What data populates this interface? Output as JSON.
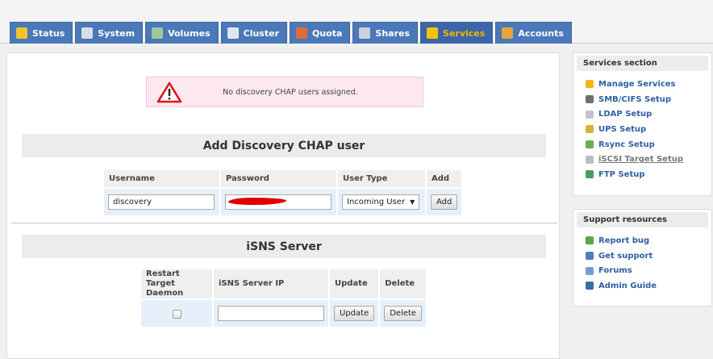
{
  "tabs": [
    {
      "label": "Status",
      "icon": "status-icon",
      "color": "#f2c230"
    },
    {
      "label": "System",
      "icon": "system-icon",
      "color": "#d8dde6"
    },
    {
      "label": "Volumes",
      "icon": "volumes-icon",
      "color": "#9fc79a"
    },
    {
      "label": "Cluster",
      "icon": "cluster-icon",
      "color": "#e2e6ee"
    },
    {
      "label": "Quota",
      "icon": "quota-icon",
      "color": "#e26b3a"
    },
    {
      "label": "Shares",
      "icon": "shares-icon",
      "color": "#c9d2de"
    },
    {
      "label": "Services",
      "icon": "services-icon",
      "color": "#f5c400",
      "active": true
    },
    {
      "label": "Accounts",
      "icon": "accounts-icon",
      "color": "#e7a43a"
    }
  ],
  "alert": {
    "message": "No discovery CHAP users assigned."
  },
  "chap": {
    "title": "Add Discovery CHAP user",
    "headers": {
      "username": "Username",
      "password": "Password",
      "user_type": "User Type",
      "add": "Add"
    },
    "username_value": "discovery",
    "user_type_value": "Incoming User",
    "add_button": "Add"
  },
  "isns": {
    "title": "iSNS Server",
    "headers": {
      "restart_1": "Restart Target",
      "restart_2": "Daemon",
      "server_ip": "iSNS Server IP",
      "update": "Update",
      "delete": "Delete"
    },
    "update_button": "Update",
    "delete_button": "Delete"
  },
  "sidebar": {
    "services_title": "Services section",
    "services": [
      {
        "label": "Manage Services",
        "icon": "manage-services-icon",
        "color": "#f2b51c"
      },
      {
        "label": "SMB/CIFS Setup",
        "icon": "smb-icon",
        "color": "#6a6f78"
      },
      {
        "label": "LDAP Setup",
        "icon": "ldap-icon",
        "color": "#bfc4cc"
      },
      {
        "label": "UPS Setup",
        "icon": "ups-icon",
        "color": "#d6b43a"
      },
      {
        "label": "Rsync Setup",
        "icon": "rsync-icon",
        "color": "#6fae4e"
      },
      {
        "label": "iSCSI Target Setup",
        "icon": "iscsi-icon",
        "color": "#b8bec8",
        "current": true
      },
      {
        "label": "FTP Setup",
        "icon": "ftp-icon",
        "color": "#4f9a5a"
      }
    ],
    "support_title": "Support resources",
    "support": [
      {
        "label": "Report bug",
        "icon": "report-bug-icon",
        "color": "#57a844"
      },
      {
        "label": "Get support",
        "icon": "get-support-icon",
        "color": "#4f7fb8"
      },
      {
        "label": "Forums",
        "icon": "forums-icon",
        "color": "#6da1d6"
      },
      {
        "label": "Admin Guide",
        "icon": "admin-guide-icon",
        "color": "#3d6aa8"
      }
    ]
  }
}
